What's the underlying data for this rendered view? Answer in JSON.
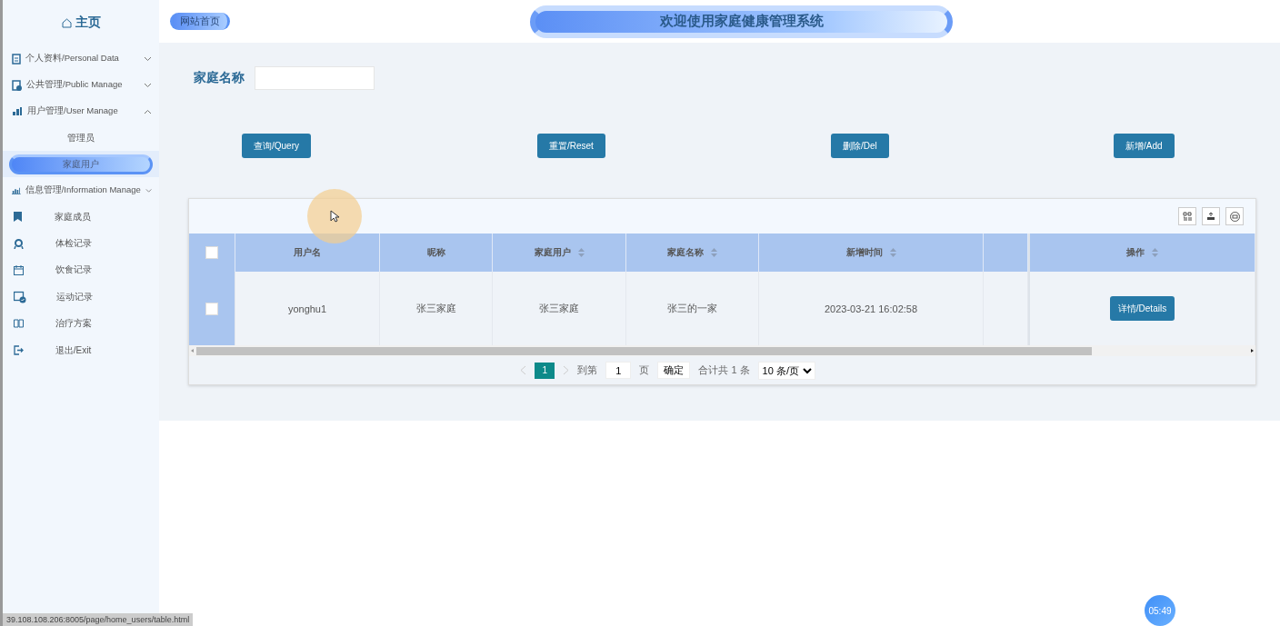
{
  "sidebar": {
    "home": "主页",
    "menus": [
      {
        "label": "个人资料/Personal Data",
        "expanded": false
      },
      {
        "label": "公共管理/Public Manage",
        "expanded": false
      },
      {
        "label": "用户管理/User Manage",
        "expanded": true,
        "children": [
          {
            "label": "管理员",
            "selected": false
          },
          {
            "label": "家庭用户",
            "selected": true
          }
        ]
      },
      {
        "label": "信息管理/Information Manage",
        "expanded": false,
        "children": [
          {
            "label": "家庭成员",
            "selected": false
          },
          {
            "label": "体检记录",
            "selected": false
          },
          {
            "label": "饮食记录",
            "selected": false
          },
          {
            "label": "运动记录",
            "selected": false
          },
          {
            "label": "治疗方案",
            "selected": false
          }
        ]
      }
    ],
    "exit": "退出/Exit"
  },
  "header": {
    "site_home": "网站首页",
    "title": "欢迎使用家庭健康管理系统"
  },
  "search": {
    "label": "家庭名称"
  },
  "buttons": [
    "查询/Query",
    "重置/Reset",
    "删除/Del",
    "新增/Add"
  ],
  "table": {
    "header_checked": false,
    "columns": [
      {
        "label": "用户名",
        "sortable": false
      },
      {
        "label": "昵称",
        "sortable": false
      },
      {
        "label": "家庭用户",
        "sortable": true
      },
      {
        "label": "家庭名称",
        "sortable": true
      },
      {
        "label": "新增时间",
        "sortable": true
      },
      {
        "sortable": false
      },
      {
        "label": "操作",
        "sortable": true
      }
    ],
    "rows": [
      {
        "checked": false,
        "cells": [
          "yonghu1",
          "张三家庭",
          "张三家庭",
          "张三的一家",
          "2023-03-21 16:02:58",
          ""
        ],
        "action": "详情/Details"
      }
    ]
  },
  "pagination": {
    "pages": [
      {
        "label": "1",
        "selected": true
      }
    ],
    "goto_label": "到第",
    "goto_value": "1",
    "page_unit": "页",
    "confirm": "确定",
    "total": "合计共 1 条",
    "page_size": "10 条/页"
  },
  "status_url": "39.108.108.206:8005/page/home_users/table.html",
  "timer": "05:49"
}
